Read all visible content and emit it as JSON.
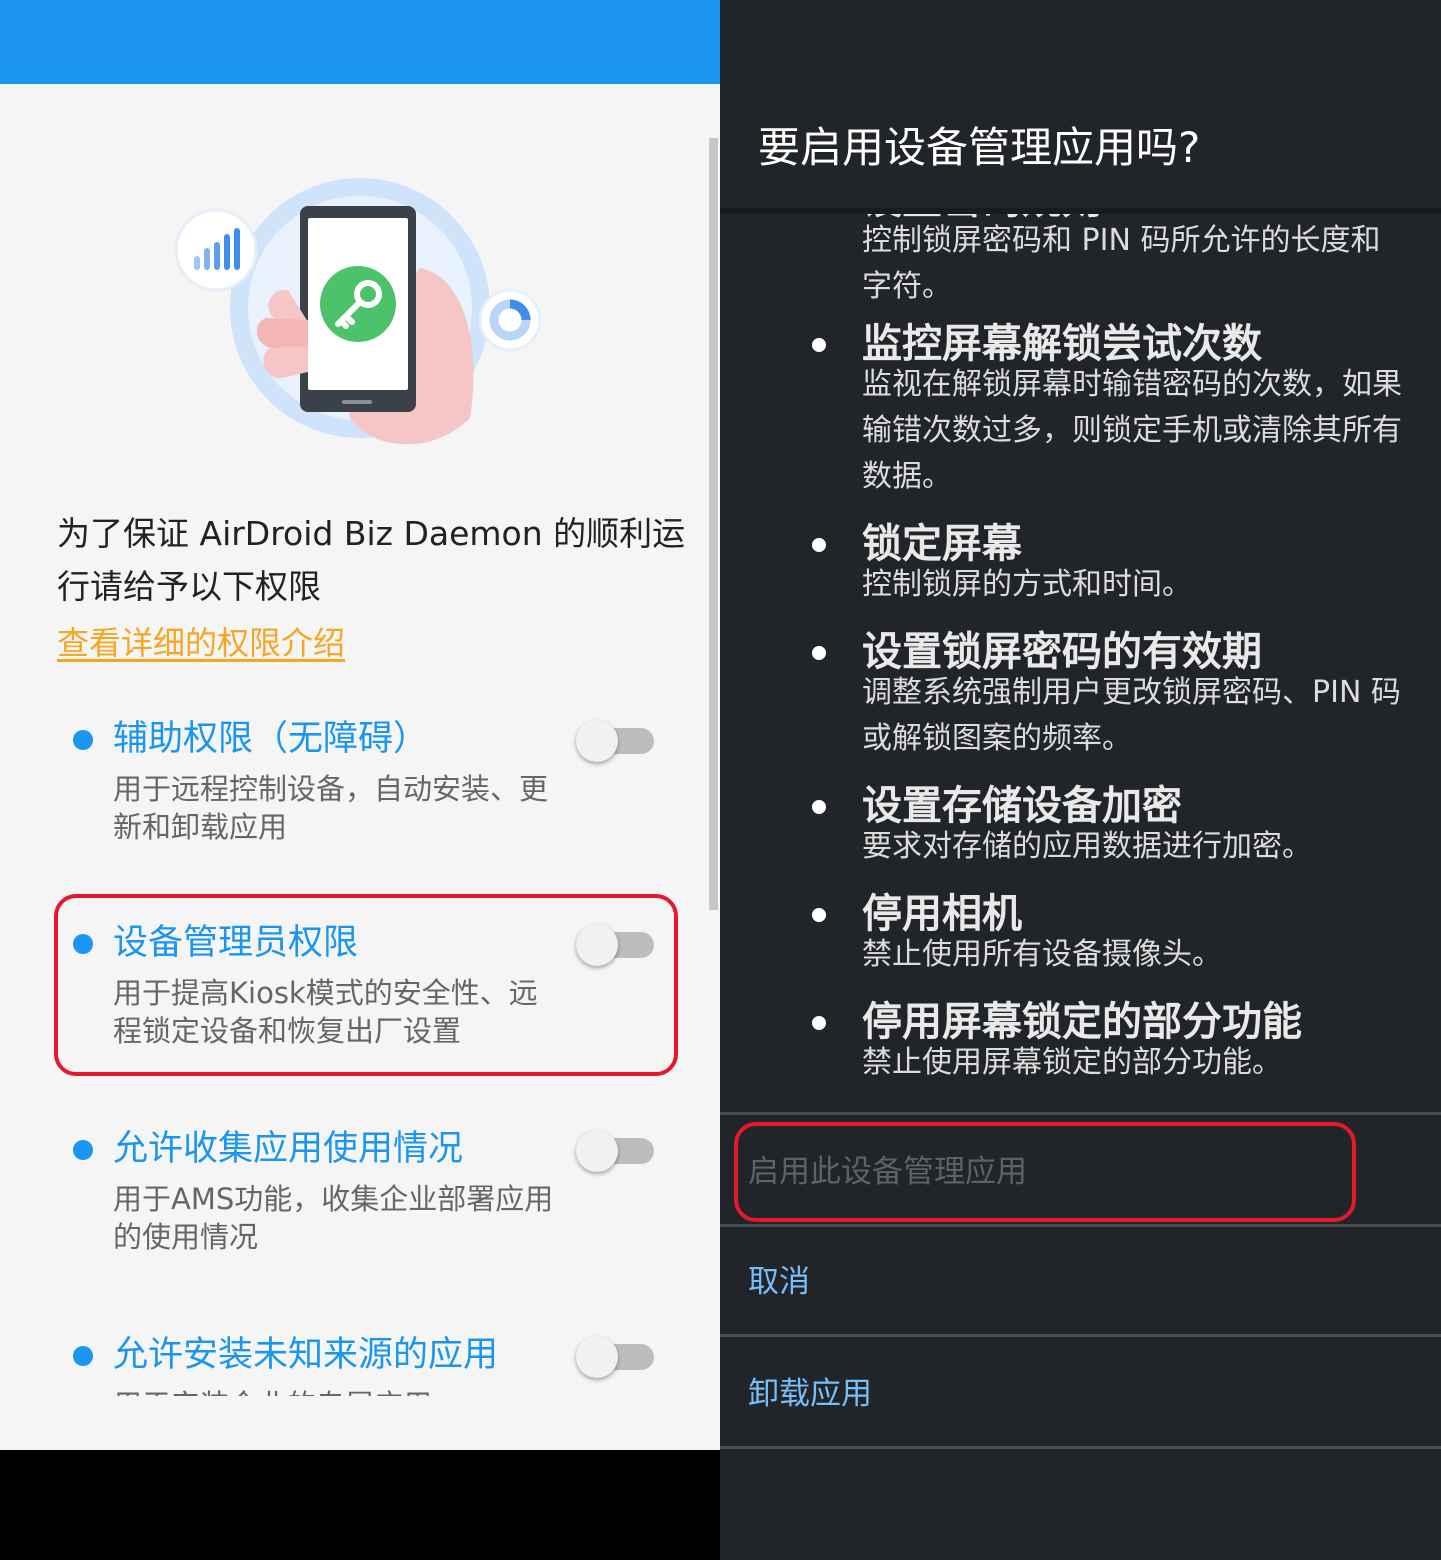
{
  "left": {
    "intro": "为了保证 AirDroid Biz Daemon 的顺利运行请给予以下权限",
    "detail_link": "查看详细的权限介绍",
    "permissions": [
      {
        "title": "辅助权限（无障碍）",
        "desc": "用于远程控制设备，自动安装、更新和卸载应用",
        "enabled": false
      },
      {
        "title": "设备管理员权限",
        "desc": "用于提高Kiosk模式的安全性、远程锁定设备和恢复出厂设置",
        "enabled": false
      },
      {
        "title": "允许收集应用使用情况",
        "desc": "用于AMS功能，收集企业部署应用的使用情况",
        "enabled": false
      },
      {
        "title": "允许安装未知来源的应用",
        "desc": "用于安装企业的专属应用",
        "enabled": false
      }
    ],
    "colors": {
      "app_bar": "#1a96f0",
      "accent": "#1a96f0",
      "link": "#f5a623",
      "highlight": "#e4192b"
    },
    "icons": [
      "signal-bars-icon",
      "key-icon",
      "pie-chart-icon",
      "phone-in-hand-illustration"
    ]
  },
  "right": {
    "dialog_title": "要启用设备管理应用吗?",
    "policies": [
      {
        "title": "设置密码规则",
        "desc": "控制锁屏密码和 PIN 码所允许的长度和字符。"
      },
      {
        "title": "监控屏幕解锁尝试次数",
        "desc": "监视在解锁屏幕时输错密码的次数，如果输错次数过多，则锁定手机或清除其所有数据。"
      },
      {
        "title": "锁定屏幕",
        "desc": "控制锁屏的方式和时间。"
      },
      {
        "title": "设置锁屏密码的有效期",
        "desc": "调整系统强制用户更改锁屏密码、PIN 码或解锁图案的频率。"
      },
      {
        "title": "设置存储设备加密",
        "desc": "要求对存储的应用数据进行加密。"
      },
      {
        "title": "停用相机",
        "desc": "禁止使用所有设备摄像头。"
      },
      {
        "title": "停用屏幕锁定的部分功能",
        "desc": "禁止使用屏幕锁定的部分功能。"
      }
    ],
    "actions": {
      "activate": "启用此设备管理应用",
      "cancel": "取消",
      "uninstall": "卸载应用"
    },
    "colors": {
      "background": "#212428",
      "action_accent": "#77bdf8",
      "disabled": "#5e6166",
      "highlight": "#e4192b"
    }
  }
}
